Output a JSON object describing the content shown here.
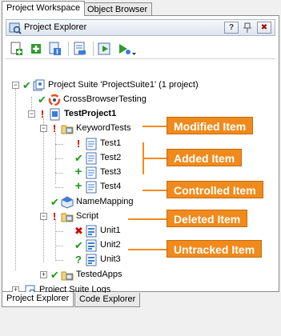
{
  "top_tabs": [
    "Project Workspace",
    "Object Browser"
  ],
  "panel": {
    "title": "Project Explorer",
    "help_label": "?",
    "close_label": "✖"
  },
  "toolbar": {
    "icons": [
      "add-item-icon",
      "add-new-icon",
      "add-existing-icon",
      "remove-icon",
      "run-icon",
      "run-dropdown-icon"
    ]
  },
  "tree": {
    "suite": "Project Suite 'ProjectSuite1' (1 project)",
    "crossbrowser": "CrossBrowserTesting",
    "project": "TestProject1",
    "keywordtests": "KeywordTests",
    "test1": "Test1",
    "test2": "Test2",
    "test3": "Test3",
    "test4": "Test4",
    "namemapping": "NameMapping",
    "script": "Script",
    "unit1": "Unit1",
    "unit2": "Unit2",
    "unit3": "Unit3",
    "testedapps": "TestedApps",
    "logs": "Project Suite Logs"
  },
  "callouts": {
    "modified": "Modified Item",
    "added": "Added Item",
    "controlled": "Controlled Item",
    "deleted": "Deleted Item",
    "untracked": "Untracked Item"
  },
  "status_marks": {
    "check": "✔",
    "excl": "!",
    "plus": "+",
    "cross": "✖",
    "quest": "?"
  },
  "bottom_tabs": [
    "Project Explorer",
    "Code Explorer"
  ],
  "colors": {
    "callout": "#f08a1c",
    "status_ok": "#1e9a1e",
    "status_error": "#d10000"
  }
}
